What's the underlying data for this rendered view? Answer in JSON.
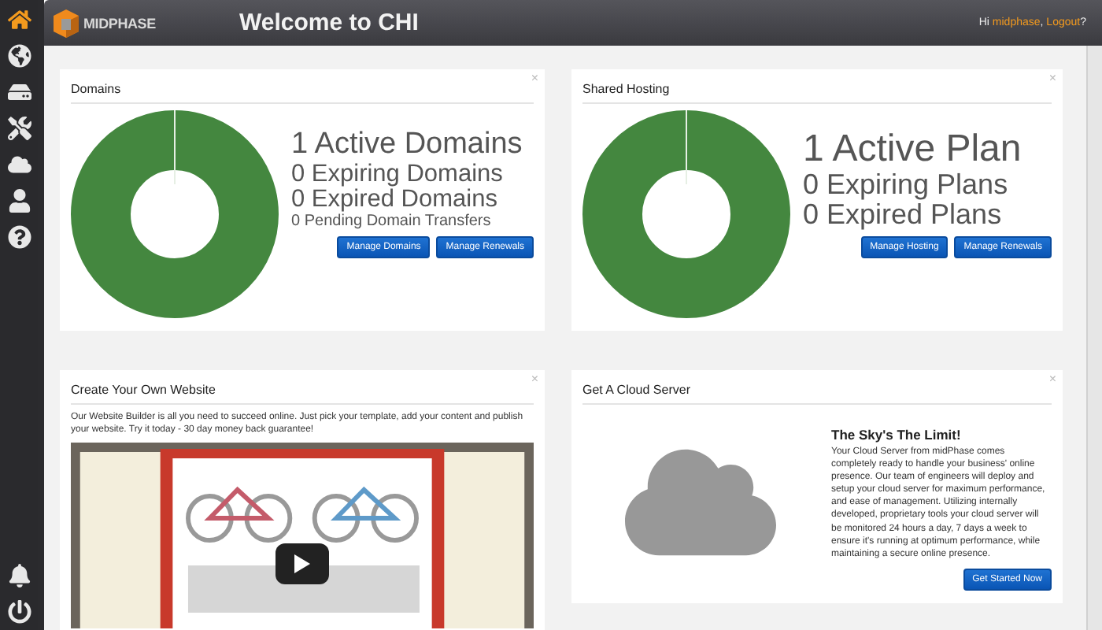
{
  "sidebar": {
    "items": [
      {
        "kind": "home",
        "selected": true
      },
      {
        "kind": "globe",
        "selected": false
      },
      {
        "kind": "drive",
        "selected": false
      },
      {
        "kind": "tools",
        "selected": false
      },
      {
        "kind": "cloud",
        "selected": false
      },
      {
        "kind": "user",
        "selected": false
      },
      {
        "kind": "help",
        "selected": false
      }
    ],
    "bottom_items": [
      {
        "kind": "bell",
        "selected": false
      },
      {
        "kind": "power",
        "selected": false
      }
    ]
  },
  "header": {
    "logo": "MIDPHASE",
    "title": "Welcome to CHI",
    "greeting": [
      {
        "kind": "text",
        "text": "Hi "
      },
      {
        "kind": "link",
        "text": "midphase"
      },
      {
        "kind": "text",
        "text": ", "
      },
      {
        "kind": "link",
        "text": "Logout"
      },
      {
        "kind": "text",
        "text": "?"
      }
    ]
  },
  "cards": [
    {
      "kind": "stats",
      "title": "Domains",
      "close": "×",
      "stats": [
        "1 Active Domains",
        "0 Expiring Domains",
        "0 Expired Domains",
        "0 Pending Domain Transfers"
      ],
      "buttons": [
        "Manage Domains",
        "Manage Renewals"
      ]
    },
    {
      "kind": "stats",
      "title": "Shared Hosting",
      "close": "×",
      "stats": [
        "1 Active Plan",
        "0 Expiring Plans",
        "0 Expired Plans"
      ],
      "buttons": [
        "Manage Hosting",
        "Manage Renewals"
      ]
    },
    {
      "kind": "website",
      "title": "Create Your Own Website",
      "close": "×",
      "text": "Our Website Builder is all you need to succeed online. Just pick your template, add your content and publish your website. Try it today - 30 day money back guarantee!"
    },
    {
      "kind": "cloud",
      "title": "Get A Cloud Server",
      "close": "×",
      "heading": "The Sky's The Limit!",
      "text": "Your Cloud Server from midPhase comes completely ready to handle your business' online presence. Our team of engineers will deploy and setup your cloud server for maximum performance, and ease of management. Utilizing internally developed, proprietary tools your cloud server will be monitored 24 hours a day, 7 days a week to ensure it's running at optimum performance, while maintaining a secure online presence.",
      "button": "Get Started Now"
    }
  ]
}
